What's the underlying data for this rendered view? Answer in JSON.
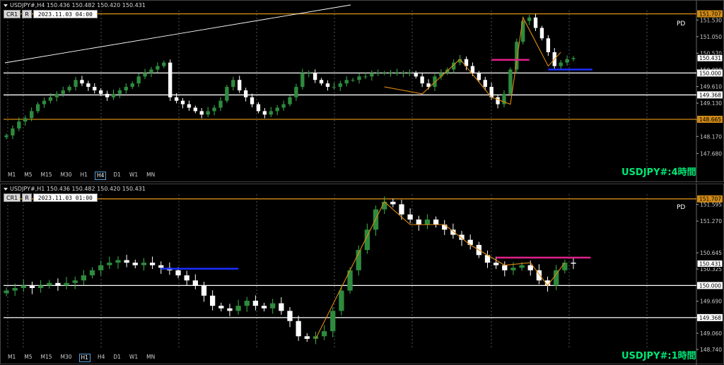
{
  "chart_data": [
    {
      "type": "candlestick",
      "symbol": "USDJPY#",
      "timeframe": "H4",
      "header": "USDJPY#,H4  150.436 150.482 150.420 150.431",
      "datetime": "2023.11.03 04:00",
      "watermark": "USDJPY#:4時間",
      "corner_label": "PD",
      "ylim": [
        147.28,
        151.8
      ],
      "price_ticks": [
        "151.530",
        "151.050",
        "150.570",
        "150.090",
        "149.610",
        "149.130",
        "148.650",
        "148.170",
        "147.680"
      ],
      "level_lines": [
        {
          "price": 151.707,
          "label": "151.707",
          "color": "#d08a16"
        },
        {
          "price": 150.431,
          "label": "150.431",
          "color": "#000000"
        },
        {
          "price": 150.0,
          "label": "150.000",
          "color": "#ffffff"
        },
        {
          "price": 149.368,
          "label": "149.368",
          "color": "#ffffff"
        },
        {
          "price": 148.665,
          "label": "148.665",
          "color": "#d08a16"
        }
      ],
      "close_series": [
        148.2,
        148.4,
        148.6,
        148.7,
        148.9,
        149.1,
        149.2,
        149.3,
        149.4,
        149.5,
        149.6,
        149.8,
        149.7,
        149.6,
        149.5,
        149.4,
        149.3,
        149.4,
        149.5,
        149.6,
        149.7,
        149.9,
        150.0,
        150.1,
        150.2,
        150.3,
        149.3,
        149.2,
        149.1,
        149.0,
        148.9,
        148.8,
        148.9,
        149.0,
        149.2,
        149.6,
        149.8,
        149.5,
        149.3,
        149.1,
        148.9,
        148.8,
        148.9,
        149.0,
        149.1,
        149.3,
        149.6,
        150.0,
        150.0,
        149.8,
        149.7,
        149.6,
        149.6,
        149.7,
        149.8,
        149.8,
        149.9,
        149.9,
        150.0,
        150.0,
        150.0,
        150.0,
        150.0,
        150.0,
        150.0,
        149.9,
        149.7,
        149.6,
        149.9,
        150.0,
        150.1,
        150.3,
        150.4,
        150.2,
        150.0,
        149.8,
        149.6,
        149.3,
        149.1,
        149.4,
        150.1,
        150.9,
        151.5,
        151.6,
        151.3,
        151.0,
        150.6,
        150.2,
        150.3,
        150.4,
        150.43
      ]
    },
    {
      "type": "candlestick",
      "symbol": "USDJPY#",
      "timeframe": "H1",
      "header": "USDJPY#,H1  150.436 150.482 150.420 150.431",
      "datetime": "2023.11.03 01:00",
      "watermark": "USDJPY#:1時間",
      "corner_label": "PD",
      "ylim": [
        148.74,
        151.8
      ],
      "price_ticks": [
        "151.595",
        "151.270",
        "150.645",
        "150.325",
        "149.690",
        "149.375",
        "149.060",
        "148.740"
      ],
      "level_lines": [
        {
          "price": 151.707,
          "label": "151.707",
          "color": "#d08a16"
        },
        {
          "price": 150.431,
          "label": "150.431",
          "color": "#000000"
        },
        {
          "price": 150.0,
          "label": "150.000",
          "color": "#ffffff"
        },
        {
          "price": 149.368,
          "label": "149.368",
          "color": "#ffffff"
        }
      ],
      "close_series": [
        149.9,
        149.95,
        150.0,
        149.95,
        150.0,
        150.05,
        150.0,
        150.05,
        150.1,
        150.2,
        150.3,
        150.4,
        150.45,
        150.5,
        150.45,
        150.4,
        150.45,
        150.4,
        150.35,
        150.3,
        150.2,
        150.1,
        150.0,
        149.8,
        149.6,
        149.55,
        149.5,
        149.6,
        149.7,
        149.6,
        149.55,
        149.65,
        149.5,
        149.3,
        149.0,
        148.95,
        149.0,
        149.1,
        149.5,
        149.9,
        150.3,
        150.7,
        151.1,
        151.5,
        151.65,
        151.6,
        151.4,
        151.3,
        151.2,
        151.3,
        151.2,
        151.1,
        151.0,
        150.9,
        150.8,
        150.6,
        150.45,
        150.4,
        150.3,
        150.35,
        150.4,
        150.3,
        150.1,
        150.0,
        150.3,
        150.45,
        150.43
      ]
    }
  ],
  "timeframe_buttons": [
    "M1",
    "M5",
    "M15",
    "M30",
    "H1",
    "H4",
    "D1",
    "W1",
    "MN"
  ],
  "panel1_active_tf": "H4",
  "panel2_active_tf": "H1",
  "cr1_label": "CR1",
  "r_label": "R"
}
